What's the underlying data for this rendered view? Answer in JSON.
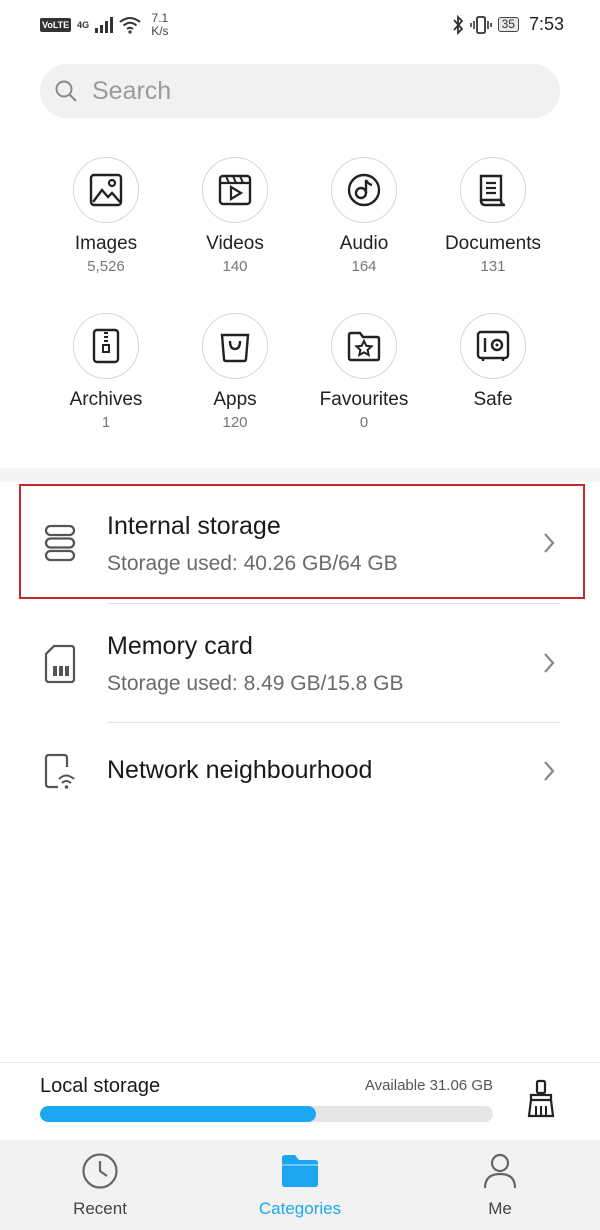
{
  "status_bar": {
    "volte": "VoLTE",
    "network": "4G",
    "speed_value": "7.1",
    "speed_unit": "K/s",
    "battery": "35",
    "time": "7:53"
  },
  "search": {
    "placeholder": "Search"
  },
  "categories": [
    {
      "label": "Images",
      "count": "5,526",
      "icon": "image-icon"
    },
    {
      "label": "Videos",
      "count": "140",
      "icon": "video-icon"
    },
    {
      "label": "Audio",
      "count": "164",
      "icon": "audio-icon"
    },
    {
      "label": "Documents",
      "count": "131",
      "icon": "document-icon"
    },
    {
      "label": "Archives",
      "count": "1",
      "icon": "archive-icon"
    },
    {
      "label": "Apps",
      "count": "120",
      "icon": "apps-icon"
    },
    {
      "label": "Favourites",
      "count": "0",
      "icon": "favourites-icon"
    },
    {
      "label": "Safe",
      "count": "",
      "icon": "safe-icon"
    }
  ],
  "storage": {
    "internal": {
      "title": "Internal storage",
      "subtitle": "Storage used: 40.26 GB/64 GB"
    },
    "memory_card": {
      "title": "Memory card",
      "subtitle": "Storage used: 8.49 GB/15.8 GB"
    },
    "network": {
      "title": "Network neighbourhood"
    }
  },
  "local_storage": {
    "label": "Local storage",
    "available": "Available 31.06 GB",
    "used_fraction": 0.61
  },
  "bottom_nav": {
    "recent": "Recent",
    "categories": "Categories",
    "me": "Me"
  },
  "colors": {
    "accent": "#1ba7f0",
    "highlight_border": "#c62828"
  }
}
